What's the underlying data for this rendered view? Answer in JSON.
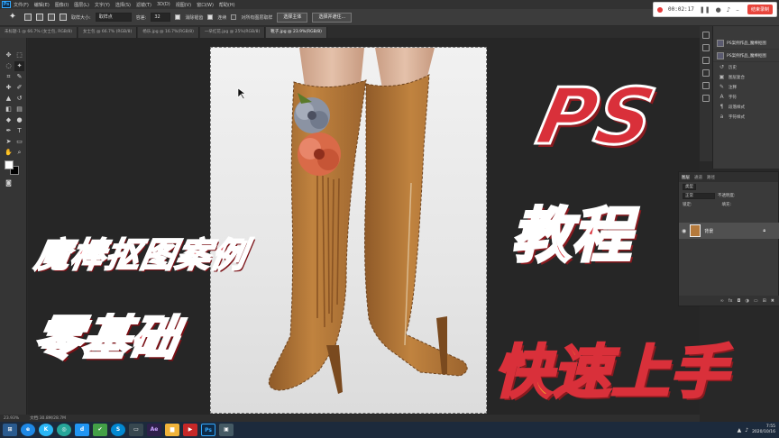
{
  "app": {
    "menu": [
      "文件(F)",
      "编辑(E)",
      "图像(I)",
      "图层(L)",
      "文字(Y)",
      "选择(S)",
      "滤镜(T)",
      "3D(D)",
      "视图(V)",
      "窗口(W)",
      "帮助(H)"
    ]
  },
  "options": {
    "sample_size_label": "取样大小:",
    "sample_size_value": "取样点",
    "tolerance_label": "容差:",
    "tolerance_value": "32",
    "anti_alias": "消除锯齿",
    "contiguous": "连续",
    "sample_all": "对所有图层取样",
    "select_subject": "选择主体",
    "select_and_mask": "选择并遮住..."
  },
  "tabs": [
    {
      "label": "未标题-1 @ 66.7% (女士包, RGB/8)",
      "active": false
    },
    {
      "label": "女士包 @ 66.7% (RGB/8)",
      "active": false
    },
    {
      "label": "杨乐.jpg @ 16.7%(RGB/8)",
      "active": false
    },
    {
      "label": "一朵红花.jpg @ 25%(RGB/8)",
      "active": false
    },
    {
      "label": "靴子.jpg @ 23.9%(RGB/8)",
      "active": true
    }
  ],
  "status": {
    "zoom": "23.93%",
    "doc": "文档:30.8M/28.7M"
  },
  "history": {
    "items": [
      "PS案例作品_魔棒抠图",
      "PS案例作品_魔棒抠图"
    ],
    "panels": [
      "历史",
      "图层复合",
      "注释",
      "字符",
      "段落样式",
      "字符样式"
    ]
  },
  "layers": {
    "tabs": [
      "图层",
      "通道",
      "路径"
    ],
    "kind_label": "类型",
    "mode_label": "正常",
    "opacity_label": "不透明度:",
    "lock_label": "锁定:",
    "fill_label": "填充:",
    "layer_name": "背景"
  },
  "recorder": {
    "time": "00:02:17",
    "stop_label": "结束录制"
  },
  "taskbar": {
    "time": "7:55",
    "date": "2020/10/16"
  },
  "overlay": {
    "ps": "PS",
    "jiaocheng": "教程",
    "mobang": "魔棒抠图案例",
    "lingjichu": "零基础",
    "kuaisu": "快速上手"
  },
  "colors": {
    "accent_red": "#d9303a",
    "accent_orange": "#f0a32e",
    "boot_brown": "#b57a3c"
  }
}
